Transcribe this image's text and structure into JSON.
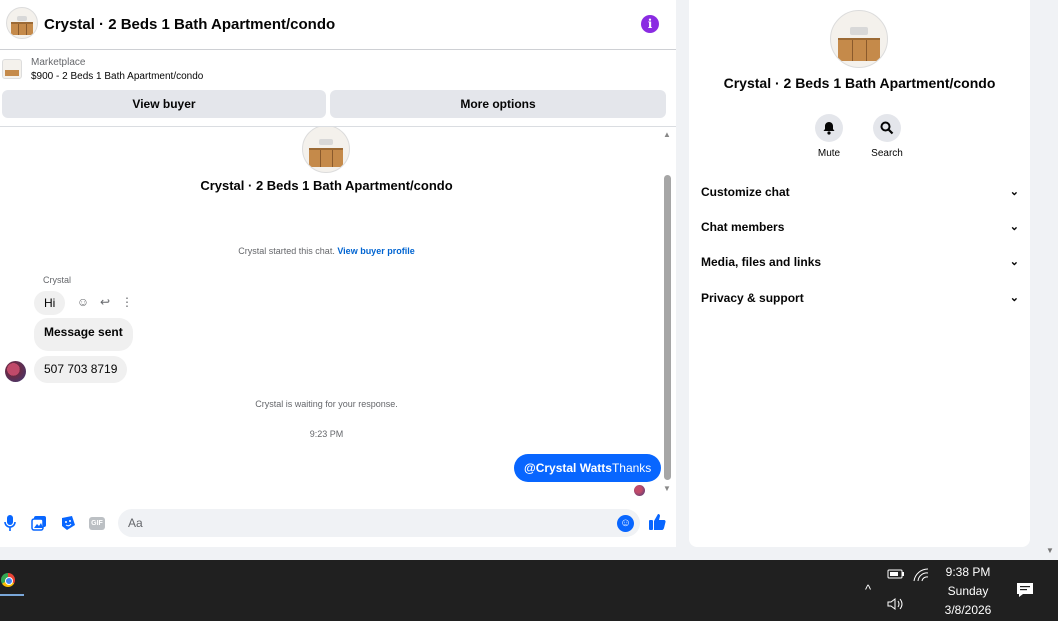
{
  "header": {
    "title": "Crystal · 2 Beds 1 Bath Apartment/condo"
  },
  "marketplace": {
    "label": "Marketplace",
    "listing": "$900 - 2 Beds 1 Bath Apartment/condo"
  },
  "buttons": {
    "view_buyer": "View buyer",
    "more_options": "More options"
  },
  "conversation": {
    "title": "Crystal · 2 Beds 1 Bath Apartment/condo",
    "started_text": "Crystal started this chat.",
    "buyer_profile_link": "View buyer profile",
    "sender_name": "Crystal",
    "messages_in": [
      "Hi",
      "Message sent",
      "507 703 8719"
    ],
    "waiting_text": "Crystal is waiting for your response.",
    "timestamp": "9:23 PM",
    "outgoing_mention": "@Crystal Watts",
    "outgoing_text": "Thanks"
  },
  "composer": {
    "placeholder": "Aa",
    "gif_label": "GIF"
  },
  "side": {
    "title": "Crystal · 2 Beds 1 Bath Apartment/condo",
    "actions": [
      {
        "label": "Mute",
        "icon": "bell-icon"
      },
      {
        "label": "Search",
        "icon": "search-icon"
      }
    ],
    "sections": [
      "Customize chat",
      "Chat members",
      "Media, files and links",
      "Privacy & support"
    ]
  },
  "taskbar": {
    "time": "9:38 PM",
    "day": "Sunday",
    "date": "3/8/2026"
  },
  "colors": {
    "messenger_blue": "#0866ff",
    "info_purple": "#8a2be2",
    "taskbar_bg": "#202020"
  }
}
